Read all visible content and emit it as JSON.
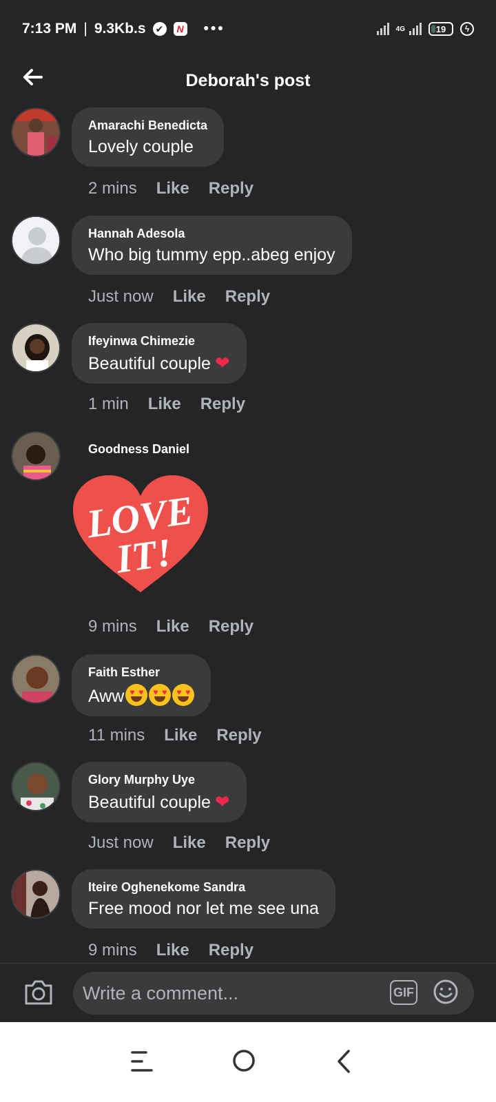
{
  "status_bar": {
    "time": "7:13 PM",
    "speed": "9.3Kb.s",
    "news_icon_label": "N",
    "more_dots": "•••",
    "network_label": "4G",
    "battery_level": "19",
    "separator": "|"
  },
  "header": {
    "title": "Deborah's post"
  },
  "comments": [
    {
      "author": "Amarachi Benedicta",
      "text": "Lovely couple",
      "time": "2 mins",
      "like": "Like",
      "reply": "Reply"
    },
    {
      "author": "Hannah Adesola",
      "text": "Who big tummy epp..abeg enjoy",
      "time": "Just now",
      "like": "Like",
      "reply": "Reply"
    },
    {
      "author": "Ifeyinwa Chimezie",
      "text": "Beautiful couple",
      "emoji": "❤",
      "time": "1 min",
      "like": "Like",
      "reply": "Reply"
    },
    {
      "author": "Goodness Daniel",
      "sticker_text_1": "LOVE",
      "sticker_text_2": "IT!",
      "time": "9 mins",
      "like": "Like",
      "reply": "Reply"
    },
    {
      "author": "Faith Esther",
      "text": "Aww",
      "time": "11 mins",
      "like": "Like",
      "reply": "Reply"
    },
    {
      "author": "Glory Murphy Uye",
      "text": "Beautiful couple",
      "emoji": "❤",
      "time": "Just now",
      "like": "Like",
      "reply": "Reply"
    },
    {
      "author": "Iteire Oghenekome Sandra",
      "text": "Free mood nor let me see una",
      "time": "9 mins",
      "like": "Like",
      "reply": "Reply"
    }
  ],
  "composer": {
    "placeholder": "Write a comment...",
    "gif_label": "GIF"
  },
  "colors": {
    "background": "#242526",
    "bubble": "#3a3b3c",
    "secondary_text": "#b0b3b8",
    "heart": "#f02849"
  }
}
